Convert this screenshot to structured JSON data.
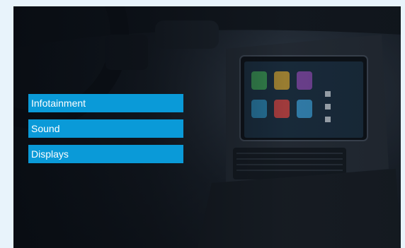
{
  "menu": {
    "items": [
      {
        "label": "Infotainment"
      },
      {
        "label": "Sound"
      },
      {
        "label": "Displays"
      }
    ]
  },
  "colors": {
    "menu_bg": "#0a9ad8",
    "page_bg": "#e8f3fb",
    "screen_tiles": [
      "#3fa35b",
      "#c9a23b",
      "#8a4fb3",
      "#2e8fbf",
      "#d24a4a",
      "#3d9fd8"
    ]
  },
  "image": {
    "subject": "car-dashboard-infotainment-photo"
  }
}
